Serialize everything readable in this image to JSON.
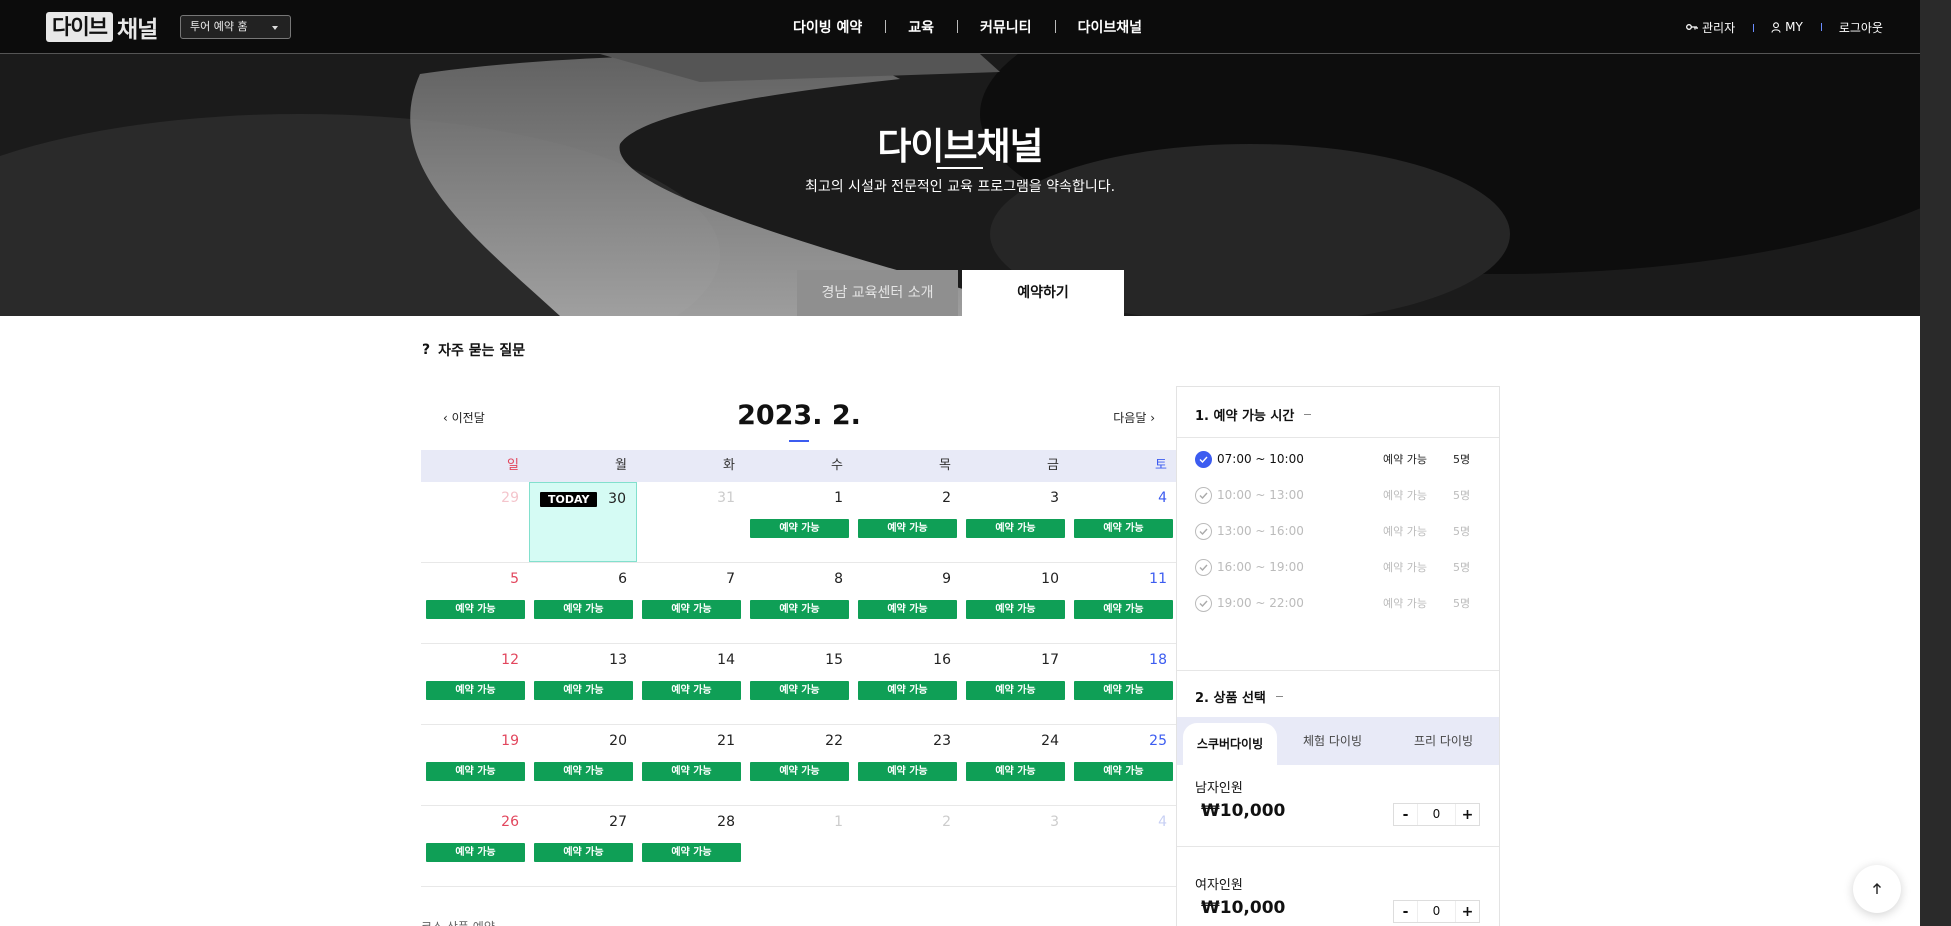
{
  "header": {
    "logo_box": "다이브",
    "logo_text": "채널",
    "home_select": "투어 예약 홈",
    "nav": [
      "다이빙 예약",
      "교육",
      "커뮤니티",
      "다이브채널"
    ],
    "admin": "관리자",
    "my": "MY",
    "logout": "로그아웃"
  },
  "hero": {
    "title": "다이브채널",
    "subtitle": "최고의 시설과 전문적인 교육 프로그램을 약속합니다.",
    "tab_intro": "경남 교육센터 소개",
    "tab_book": "예약하기"
  },
  "faq": {
    "icon": "?",
    "label": "자주 묻는 질문"
  },
  "calendar": {
    "prev": "이전달",
    "next": "다음달",
    "month": "2023. 2.",
    "weekdays": [
      "일",
      "월",
      "화",
      "수",
      "목",
      "금",
      "토"
    ],
    "today_label": "TODAY",
    "avail_label": "예약 가능",
    "weeks": [
      [
        {
          "d": "29",
          "dim": true
        },
        {
          "d": "30",
          "today": true
        },
        {
          "d": "31",
          "dim": true
        },
        {
          "d": "1",
          "a": true
        },
        {
          "d": "2",
          "a": true
        },
        {
          "d": "3",
          "a": true
        },
        {
          "d": "4",
          "a": true
        }
      ],
      [
        {
          "d": "5",
          "a": true
        },
        {
          "d": "6",
          "a": true
        },
        {
          "d": "7",
          "a": true
        },
        {
          "d": "8",
          "a": true
        },
        {
          "d": "9",
          "a": true
        },
        {
          "d": "10",
          "a": true
        },
        {
          "d": "11",
          "a": true
        }
      ],
      [
        {
          "d": "12",
          "a": true
        },
        {
          "d": "13",
          "a": true
        },
        {
          "d": "14",
          "a": true
        },
        {
          "d": "15",
          "a": true
        },
        {
          "d": "16",
          "a": true
        },
        {
          "d": "17",
          "a": true
        },
        {
          "d": "18",
          "a": true
        }
      ],
      [
        {
          "d": "19",
          "a": true
        },
        {
          "d": "20",
          "a": true
        },
        {
          "d": "21",
          "a": true
        },
        {
          "d": "22",
          "a": true
        },
        {
          "d": "23",
          "a": true
        },
        {
          "d": "24",
          "a": true
        },
        {
          "d": "25",
          "a": true
        }
      ],
      [
        {
          "d": "26",
          "a": true
        },
        {
          "d": "27",
          "a": true
        },
        {
          "d": "28",
          "a": true
        },
        {
          "d": "1",
          "dim": true
        },
        {
          "d": "2",
          "dim": true
        },
        {
          "d": "3",
          "dim": true
        },
        {
          "d": "4",
          "dim": true
        }
      ]
    ],
    "below_text": "코스 상품 예약"
  },
  "panel": {
    "time_title": "1. 예약 가능 시간",
    "slots": [
      {
        "time": "07:00 ~ 10:00",
        "state": "예약 가능",
        "count": "5명",
        "selected": true
      },
      {
        "time": "10:00 ~ 13:00",
        "state": "예약 가능",
        "count": "5명",
        "selected": false
      },
      {
        "time": "13:00 ~ 16:00",
        "state": "예약 가능",
        "count": "5명",
        "selected": false
      },
      {
        "time": "16:00 ~ 19:00",
        "state": "예약 가능",
        "count": "5명",
        "selected": false
      },
      {
        "time": "19:00 ~ 22:00",
        "state": "예약 가능",
        "count": "5명",
        "selected": false
      }
    ],
    "product_title": "2. 상품 선택",
    "product_tabs": [
      "스쿠버다이빙",
      "체험 다이빙",
      "프리 다이빙"
    ],
    "products": [
      {
        "label": "남자인원",
        "price": "₩10,000",
        "qty": "0"
      },
      {
        "label": "여자인원",
        "price": "₩10,000",
        "qty": "0"
      }
    ],
    "minus": "-",
    "plus": "+"
  },
  "colors": {
    "accent": "#3c5cf0",
    "available": "#0f9f56",
    "sunday": "#e2465d",
    "today_bg": "#d5fbf4"
  },
  "to_top_icon": "arrow-up-icon"
}
